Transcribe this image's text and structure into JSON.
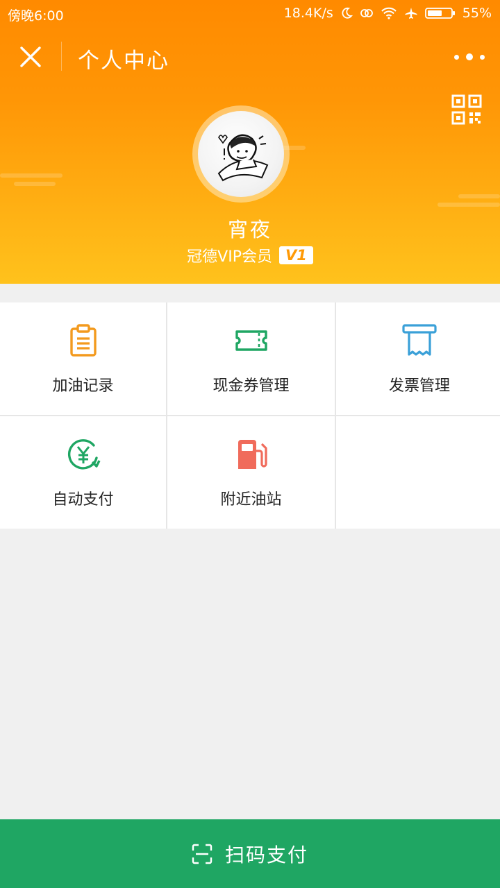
{
  "status": {
    "time": "傍晚6:00",
    "speed": "18.4K/s",
    "battery": "55%"
  },
  "nav": {
    "title": "个人中心"
  },
  "profile": {
    "name": "宵夜",
    "member": "冠德VIP会员",
    "level": "V1"
  },
  "menu": [
    {
      "label": "加油记录",
      "icon": "clipboard-icon",
      "color": "#f39a1e"
    },
    {
      "label": "现金券管理",
      "icon": "ticket-icon",
      "color": "#1fa663"
    },
    {
      "label": "发票管理",
      "icon": "receipt-icon",
      "color": "#3aa0d8"
    },
    {
      "label": "自动支付",
      "icon": "auto-pay-icon",
      "color": "#1fa663"
    },
    {
      "label": "附近油站",
      "icon": "fuel-pump-icon",
      "color": "#f06b5b"
    }
  ],
  "footer": {
    "pay_label": "扫码支付"
  },
  "colors": {
    "header_top": "#ff8a00",
    "header_bottom": "#ffc21c",
    "pay_bar": "#1fa663"
  }
}
